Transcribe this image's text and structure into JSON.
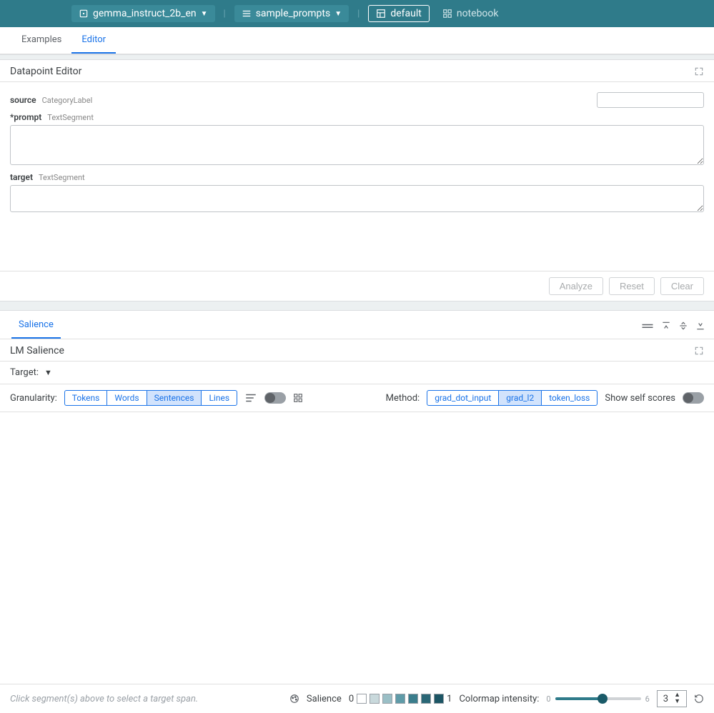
{
  "topbar": {
    "model_label": "gemma_instruct_2b_en",
    "dataset_label": "sample_prompts",
    "layout_label": "default",
    "notebook_label": "notebook"
  },
  "topTabs": {
    "examples": "Examples",
    "editor": "Editor"
  },
  "datapoint": {
    "panel_title": "Datapoint Editor",
    "source": {
      "label": "source",
      "type": "CategoryLabel",
      "value": ""
    },
    "prompt": {
      "label": "*prompt",
      "type": "TextSegment",
      "value": ""
    },
    "target": {
      "label": "target",
      "type": "TextSegment",
      "value": ""
    },
    "buttons": {
      "analyze": "Analyze",
      "reset": "Reset",
      "clear": "Clear"
    }
  },
  "salienceTabs": {
    "salience": "Salience"
  },
  "lmSalience": {
    "panel_title": "LM Salience",
    "target_label": "Target:",
    "granularity_label": "Granularity:",
    "granularity_options": {
      "tokens": "Tokens",
      "words": "Words",
      "sentences": "Sentences",
      "lines": "Lines"
    },
    "method_label": "Method:",
    "method_options": {
      "grad_dot_input": "grad_dot_input",
      "grad_l2": "grad_l2",
      "token_loss": "token_loss"
    },
    "show_self_scores_label": "Show self scores"
  },
  "bottom": {
    "hint": "Click segment(s) above to select a target span.",
    "salience_label": "Salience",
    "legend_min": "0",
    "legend_max": "1",
    "colormap_label": "Colormap intensity:",
    "slider_min": "0",
    "slider_max": "6",
    "num_value": "3",
    "legend_colors": [
      "#ffffff",
      "#c9d9dc",
      "#9abfc6",
      "#5f9ba8",
      "#3a7d8c",
      "#2a6776",
      "#1c5564"
    ]
  }
}
